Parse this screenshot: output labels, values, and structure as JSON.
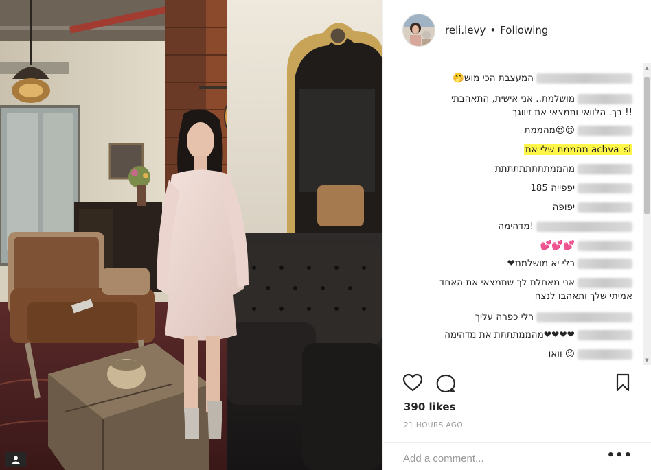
{
  "post": {
    "username": "reli.levy",
    "separator": "•",
    "follow_state": "Following",
    "likes": "390 likes",
    "time": "21 HOURS AGO",
    "comment_placeholder": "Add a comment...",
    "more_label": "•••"
  },
  "comments": [
    {
      "text": "המעצבת הכי מוש🤭",
      "user_len": "long"
    },
    {
      "text": "מושלמת.. אני אישית, התאהבתי",
      "user_len": "short"
    },
    {
      "text": "!! בך. הלוואי ותמצאי את זיווגך",
      "user_len": "none"
    },
    {
      "text": "😍😍מהממת",
      "user_len": "short"
    },
    {
      "text": "achva_si מהממת שלי את",
      "user_len": "none",
      "highlight": true
    },
    {
      "text": "מהממתתתתתתתתת",
      "user_len": "short"
    },
    {
      "text": "יפפייה 185",
      "user_len": "short"
    },
    {
      "text": "יפופה",
      "user_len": "short"
    },
    {
      "text": "!מדהימה",
      "user_len": "long"
    },
    {
      "text": "💕💕💕",
      "user_len": "short"
    },
    {
      "text": "רלי יא מושלמת❤",
      "user_len": "short"
    },
    {
      "text": "אני מאחלת לך שתמצאי את האחד",
      "user_len": "short"
    },
    {
      "text": "אמיתי שלך ותאהבו לנצח",
      "user_len": "none"
    },
    {
      "text": "רלי כפרה עליך",
      "user_len": "long"
    },
    {
      "text": "❤❤❤❤מהממתתתת את מדהימה",
      "user_len": "short"
    },
    {
      "text": "😉 וואו",
      "user_len": "short"
    }
  ],
  "icons": {
    "like": "heart-icon",
    "comment": "comment-bubble-icon",
    "save": "bookmark-icon",
    "tag": "user-tag-icon",
    "more": "more-options-icon"
  },
  "colors": {
    "text": "#262626",
    "muted": "#999999",
    "highlight": "#fff64a",
    "border": "#efefef"
  }
}
